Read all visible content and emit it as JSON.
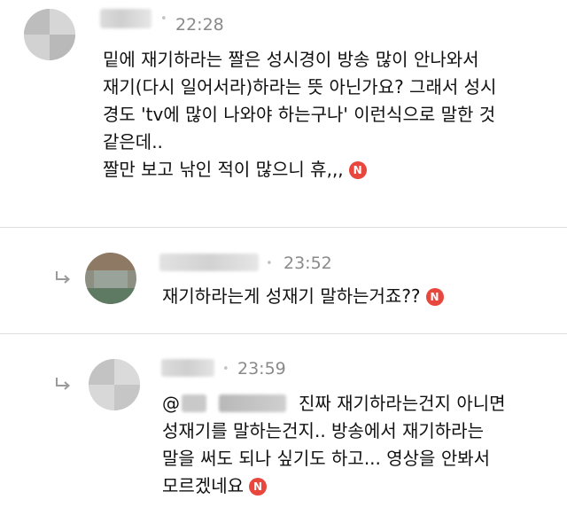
{
  "badge_letter": "N",
  "accent_color": "#e8473d",
  "comments": [
    {
      "time": "22:28",
      "lines": [
        "밑에 재기하라는 짤은 성시경이 방송 많이 안나와서",
        "재기(다시 일어서라)하라는 뜻 아닌가요? 그래서 성시",
        "경도 'tv에 많이 나와야 하는구나' 이런식으로 말한 것",
        "같은데..",
        "짤만 보고 낚인 적이 많으니 휴,,,"
      ]
    },
    {
      "time": "23:52",
      "lines": [
        "재기하라는게 성재기 말하는거죠??"
      ]
    },
    {
      "time": "23:59",
      "mention_prefix": "@",
      "lines": [
        "진짜 재기하라는건지 아니면",
        "성재기를 말하는건지.. 방송에서 재기하라는",
        "말을 써도 되나 싶기도 하고... 영상을 안봐서",
        "모르겠네요"
      ]
    }
  ]
}
